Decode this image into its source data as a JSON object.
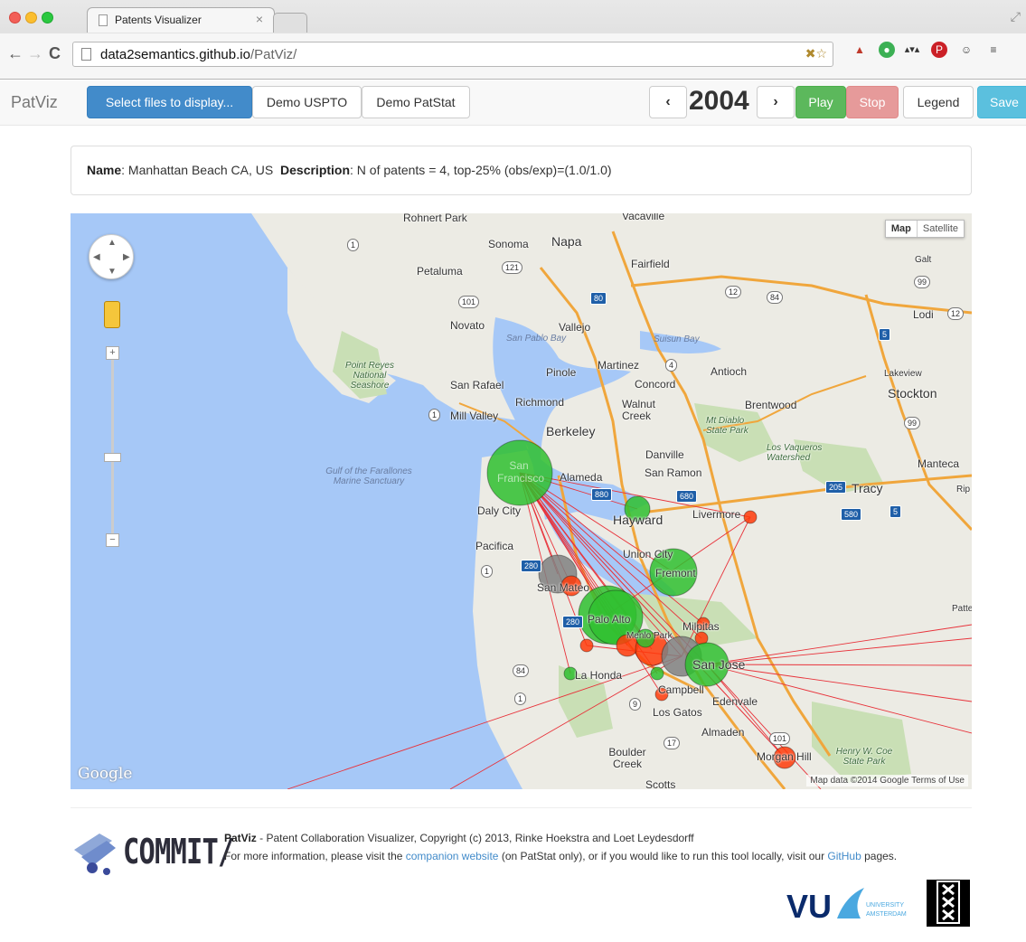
{
  "browser": {
    "tab_title": "Patents Visualizer",
    "tab_close": "×",
    "url_host": "data2semantics.github.io",
    "url_path": "/PatViz/",
    "back": "←",
    "forward": "→",
    "reload": "C"
  },
  "navbar": {
    "brand": "PatViz",
    "select_files": "Select files to display...",
    "demo_uspto": "Demo USPTO",
    "demo_patstat": "Demo PatStat",
    "prev": "‹",
    "year": "2004",
    "next": "›",
    "play": "Play",
    "stop": "Stop",
    "legend": "Legend",
    "save": "Save"
  },
  "info": {
    "name_label": "Name",
    "name_value": ": Manhattan Beach CA, US",
    "description_label": "Description",
    "description_value": ": N of patents = 4, top-25% (obs/exp)=(1.0/1.0)"
  },
  "map": {
    "type_map": "Map",
    "type_satellite": "Satellite",
    "zoom_in": "+",
    "zoom_out": "−",
    "google": "Google",
    "attribution": "Map data ©2014 Google   Terms of Use",
    "colors": {
      "green": "#2fbf2f",
      "gray": "#808080",
      "red": "#ff3b0a",
      "link": "#e8323a",
      "water": "#a6c8f7",
      "land": "#ecebe4"
    },
    "places": [
      "Rohnert Park",
      "Vacaville",
      "Sonoma",
      "Napa",
      "Petaluma",
      "Fairfield",
      "Galt",
      "Novato",
      "Vallejo",
      "San Pablo Bay",
      "Suisun Bay",
      "Lodi",
      "Point Reyes National Seashore",
      "Pinole",
      "Martinez",
      "Antioch",
      "San Rafael",
      "Concord",
      "Lakeview",
      "Stockton",
      "Richmond",
      "Walnut Creek",
      "Brentwood",
      "Mill Valley",
      "Berkeley",
      "Mt Diablo State Park",
      "Gulf of the Farallones Marine Sanctuary",
      "Danville",
      "Los Vaqueros Watershed",
      "San Francisco",
      "Alameda",
      "San Ramon",
      "Manteca",
      "Tracy",
      "Daly City",
      "Hayward",
      "Livermore",
      "Rip",
      "Pacifica",
      "Union City",
      "Fremont",
      "San Mateo",
      "Patte",
      "Palo Alto",
      "Milpitas",
      "Menlo Park",
      "La Honda",
      "San Jose",
      "Campbell",
      "Los Gatos",
      "Edenvale",
      "Almaden",
      "Boulder Creek",
      "Morgan Hill",
      "Henry W. Coe State Park",
      "Scotts"
    ]
  },
  "footer": {
    "commit": "COMMIT/",
    "patviz_bold": "PatViz",
    "line1_rest": " - Patent Collaboration Visualizer, Copyright (c) 2013, Rinke Hoekstra and Loet Leydesdorff",
    "line2_a": "For more information, please visit the ",
    "companion": "companion website",
    "line2_b": " (on PatStat only), or if you would like to run this tool locally, visit our ",
    "github": "GitHub",
    "line2_c": " pages.",
    "vu": "VU",
    "vu_sub1": "UNIVERSITY",
    "vu_sub2": "AMSTERDAM"
  }
}
